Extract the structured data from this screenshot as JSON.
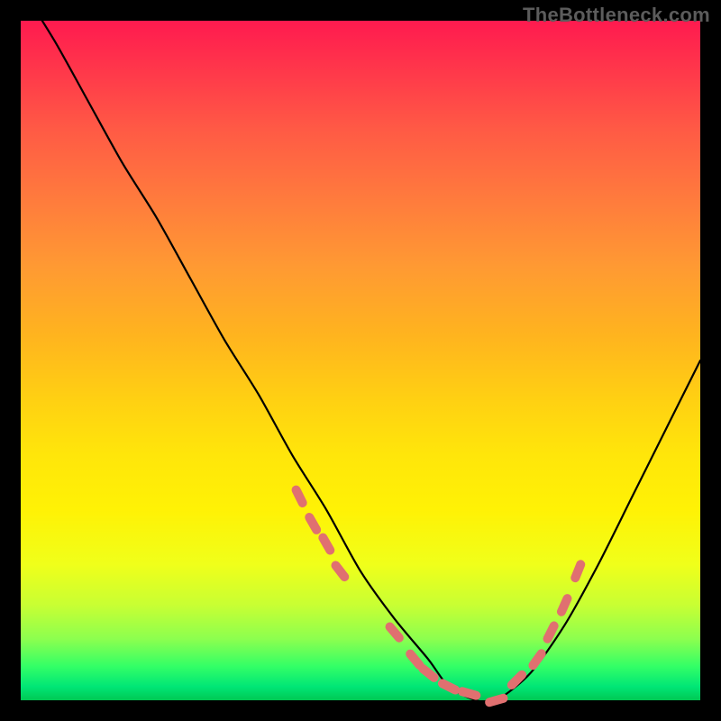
{
  "watermark": "TheBottleneck.com",
  "colors": {
    "background": "#000000",
    "curve": "#000000",
    "marker": "#e07070",
    "gradient_top": "#ff1a4f",
    "gradient_bottom": "#00c853"
  },
  "chart_data": {
    "type": "line",
    "title": "",
    "xlabel": "",
    "ylabel": "",
    "xlim": [
      0,
      100
    ],
    "ylim": [
      0,
      100
    ],
    "grid": false,
    "legend": false,
    "series": [
      {
        "name": "bottleneck-curve",
        "x": [
          0,
          5,
          10,
          15,
          20,
          25,
          30,
          35,
          40,
          45,
          50,
          55,
          60,
          63,
          67,
          70,
          75,
          80,
          85,
          90,
          95,
          100
        ],
        "values": [
          105,
          97,
          88,
          79,
          71,
          62,
          53,
          45,
          36,
          28,
          19,
          12,
          6,
          2,
          0,
          0,
          4,
          11,
          20,
          30,
          40,
          50
        ]
      }
    ],
    "markers": {
      "name": "highlight-dots",
      "x": [
        41,
        43,
        45,
        47,
        55,
        58,
        60,
        63,
        66,
        70,
        73,
        76,
        78,
        80,
        82
      ],
      "values": [
        30,
        26,
        23,
        19,
        10,
        6,
        4,
        2,
        1,
        0,
        3,
        6,
        10,
        14,
        19
      ]
    }
  }
}
